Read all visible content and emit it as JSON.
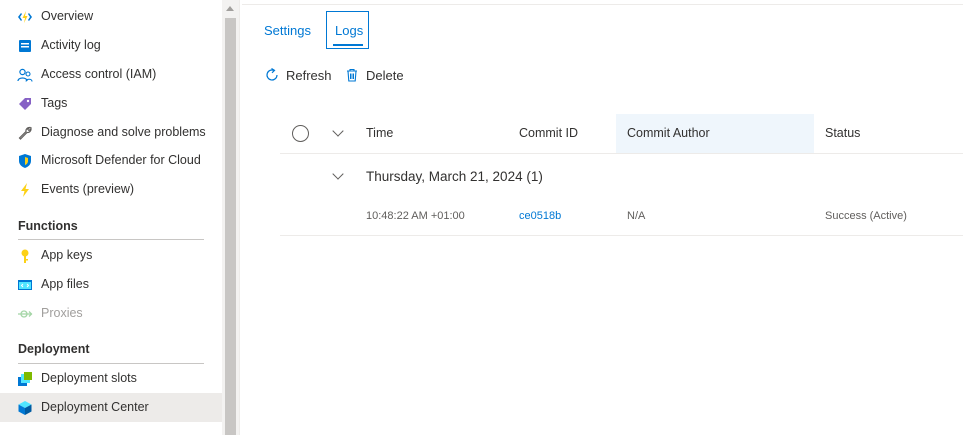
{
  "sidebar": {
    "items": [
      {
        "label": "Overview",
        "icon": "function-app-icon"
      },
      {
        "label": "Activity log",
        "icon": "activity-log-icon"
      },
      {
        "label": "Access control (IAM)",
        "icon": "people-icon"
      },
      {
        "label": "Tags",
        "icon": "tag-icon"
      },
      {
        "label": "Diagnose and solve problems",
        "icon": "wrench-icon"
      },
      {
        "label": "Microsoft Defender for Cloud",
        "icon": "shield-icon"
      },
      {
        "label": "Events (preview)",
        "icon": "lightning-icon"
      }
    ],
    "sections": [
      {
        "title": "Functions",
        "items": [
          {
            "label": "App keys",
            "icon": "key-icon"
          },
          {
            "label": "App files",
            "icon": "code-file-icon"
          },
          {
            "label": "Proxies",
            "icon": "proxy-icon",
            "disabled": true
          }
        ]
      },
      {
        "title": "Deployment",
        "items": [
          {
            "label": "Deployment slots",
            "icon": "deployment-slots-icon"
          },
          {
            "label": "Deployment Center",
            "icon": "cube-icon",
            "selected": true
          }
        ]
      }
    ]
  },
  "tabs": {
    "settings": "Settings",
    "logs": "Logs",
    "active": "Logs"
  },
  "commands": {
    "refresh": "Refresh",
    "delete": "Delete"
  },
  "table": {
    "columns": {
      "time": "Time",
      "commit_id": "Commit ID",
      "commit_author": "Commit Author",
      "status": "Status"
    },
    "group": {
      "label": "Thursday, March 21, 2024 (1)"
    },
    "rows": [
      {
        "time": "10:48:22 AM +01:00",
        "commit_id": "ce0518b",
        "commit_author": "N/A",
        "status": "Success (Active)"
      }
    ]
  },
  "colors": {
    "accent": "#0078d4",
    "selected_bg": "#edebe9",
    "header_highlight": "#eff6fc"
  }
}
